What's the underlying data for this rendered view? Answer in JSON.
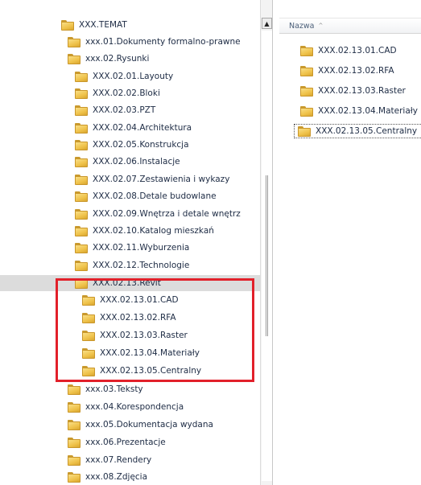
{
  "tree": {
    "items": [
      {
        "label": "XXX.TEMAT"
      },
      {
        "label": "xxx.01.Dokumenty formalno-prawne"
      },
      {
        "label": "xxx.02.Rysunki"
      },
      {
        "label": "XXX.02.01.Layouty"
      },
      {
        "label": "XXX.02.02.Bloki"
      },
      {
        "label": "XXX.02.03.PZT"
      },
      {
        "label": "XXX.02.04.Architektura"
      },
      {
        "label": "XXX.02.05.Konstrukcja"
      },
      {
        "label": "XXX.02.06.Instalacje"
      },
      {
        "label": "XXX.02.07.Zestawienia i wykazy"
      },
      {
        "label": "XXX.02.08.Detale budowlane"
      },
      {
        "label": "XXX.02.09.Wnętrza i detale wnętrz"
      },
      {
        "label": "XXX.02.10.Katalog mieszkań"
      },
      {
        "label": "XXX.02.11.Wyburzenia"
      },
      {
        "label": "XXX.02.12.Technologie"
      },
      {
        "label": "XXX.02.13.Revit"
      },
      {
        "label": "XXX.02.13.01.CAD"
      },
      {
        "label": "XXX.02.13.02.RFA"
      },
      {
        "label": "XXX.02.13.03.Raster"
      },
      {
        "label": "XXX.02.13.04.Materiały"
      },
      {
        "label": "XXX.02.13.05.Centralny"
      },
      {
        "label": "xxx.03.Teksty"
      },
      {
        "label": "xxx.04.Korespondencja"
      },
      {
        "label": "xxx.05.Dokumentacja wydana"
      },
      {
        "label": "xxx.06.Prezentacje"
      },
      {
        "label": "xxx.07.Rendery"
      },
      {
        "label": "xxx.08.Zdjęcia"
      }
    ]
  },
  "list": {
    "column_header": "Nazwa",
    "items": [
      {
        "label": "XXX.02.13.01.CAD"
      },
      {
        "label": "XXX.02.13.02.RFA"
      },
      {
        "label": "XXX.02.13.03.Raster"
      },
      {
        "label": "XXX.02.13.04.Materiały"
      },
      {
        "label": "XXX.02.13.05.Centralny"
      }
    ]
  },
  "colors": {
    "highlight_border": "#e2202a",
    "selected_row": "#dcdcdc",
    "folder": "#efc24a"
  }
}
